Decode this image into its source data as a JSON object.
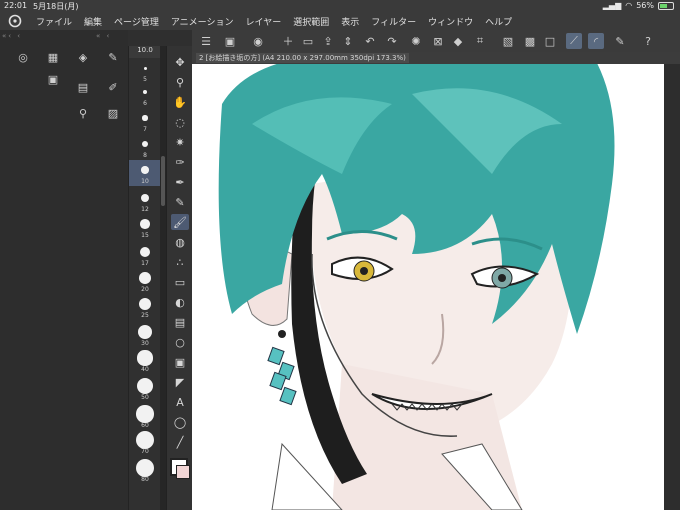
{
  "status": {
    "time": "22:01",
    "date": "5月18日(月)",
    "battery": "56%",
    "battery_level": 0.56
  },
  "menu": {
    "items": [
      "ファイル",
      "編集",
      "ページ管理",
      "アニメーション",
      "レイヤー",
      "選択範囲",
      "表示",
      "フィルター",
      "ウィンドウ",
      "ヘルプ"
    ]
  },
  "canvas_tab": {
    "label": "2 [お絵描き垢の方] (A4 210.00 x 297.00mm 350dpi 173.3%)"
  },
  "brush": {
    "current_size": "10.0",
    "sizes": [
      "5",
      "6",
      "7",
      "8",
      "10",
      "12",
      "15",
      "17",
      "20",
      "25",
      "30",
      "40",
      "50",
      "60",
      "70",
      "80"
    ],
    "selected": "10"
  },
  "colors": {
    "main": "#ffffff",
    "sub": "#f2d6d6",
    "accent": "#4d5a72"
  },
  "icons": {
    "toolbar": [
      "menu-icon",
      "save-icon",
      "record-icon",
      "new-page-icon",
      "open-folder-icon",
      "export-icon",
      "stepper-icon",
      "undo-icon",
      "redo-icon",
      "loading-icon",
      "clear-icon",
      "fill-icon",
      "transform-icon",
      "hide-icon",
      "crop-icon",
      "deselect-icon",
      "ruler-icon",
      "brush-curve-icon",
      "pen-pressure-icon",
      "help-icon"
    ],
    "tools": [
      "move-icon",
      "zoom-icon",
      "hand-icon",
      "lasso-icon",
      "magic-wand-icon",
      "eyedropper-icon",
      "pen-icon",
      "pencil-icon",
      "brush-icon",
      "fill-icon",
      "spray-icon",
      "eraser-icon",
      "bucket-icon",
      "gradient-icon",
      "shape-icon",
      "frame-icon",
      "ruler-tool-icon",
      "text-icon",
      "balloon-icon",
      "line-icon"
    ]
  }
}
